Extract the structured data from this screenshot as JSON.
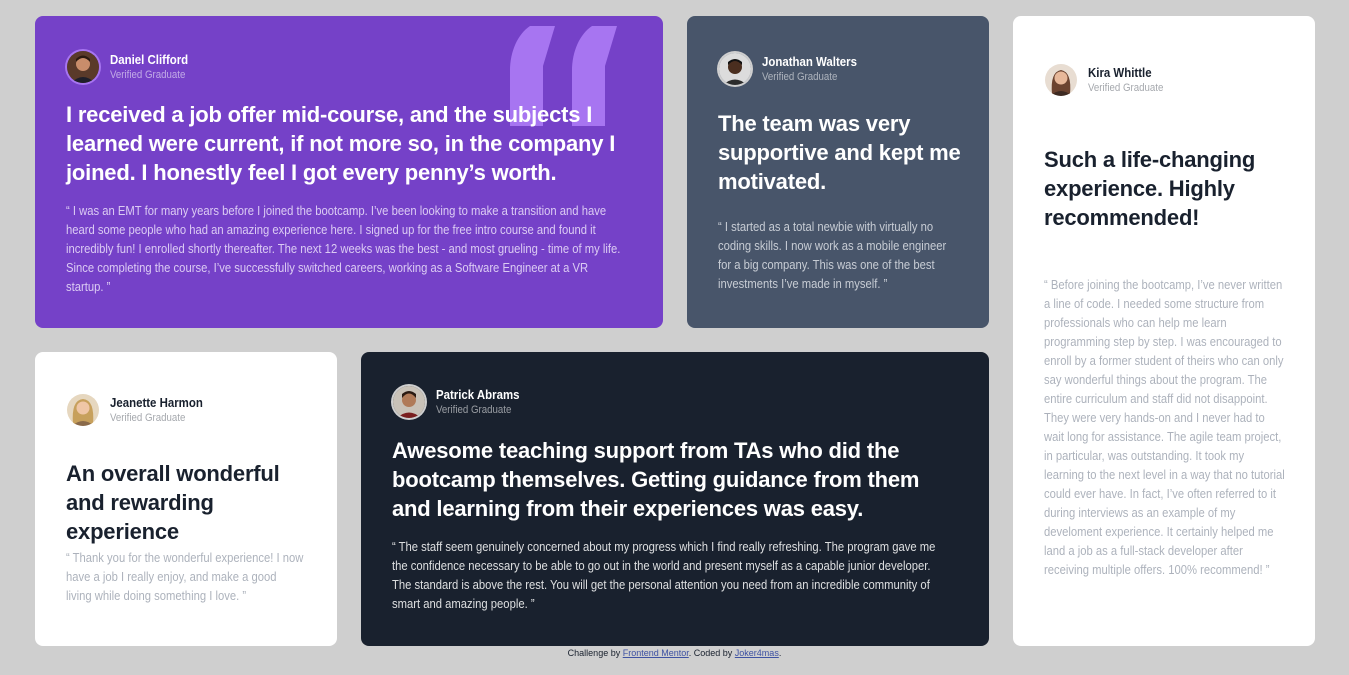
{
  "theme": {
    "daniel_bg": "#7541c8",
    "jonathan_bg": "#48556a",
    "kira_bg": "#ffffff",
    "jeanette_bg": "#ffffff",
    "patrick_bg": "#19212e",
    "page_bg": "#cfcfcf",
    "quote_mark_color": "#a775f1"
  },
  "testimonials": {
    "daniel": {
      "name": "Daniel Clifford",
      "role": "Verified Graduate",
      "avatar_icon": "avatar-daniel",
      "headline": "I received a job offer mid-course, and the subjects I learned were current, if not more so, in the company I joined. I honestly feel I got every penny’s worth.",
      "body": "“ I was an EMT for many years before I joined the bootcamp. I’ve been looking to make a transition and have heard some people who had an amazing experience here. I signed up for the free intro course and found it incredibly fun! I enrolled shortly thereafter. The next 12 weeks was the best - and most grueling - time of my life. Since completing the course, I’ve successfully switched careers, working as a Software Engineer at a VR startup. ”"
    },
    "jonathan": {
      "name": "Jonathan Walters",
      "role": "Verified Graduate",
      "avatar_icon": "avatar-jonathan",
      "headline": "The team was very supportive and kept me motivated.",
      "body": "“ I started as a total newbie with virtually no coding skills. I now work as a mobile engineer for a big company. This was one of the best investments I’ve made in myself. ”"
    },
    "kira": {
      "name": "Kira Whittle",
      "role": "Verified Graduate",
      "avatar_icon": "avatar-kira",
      "headline": "Such a life-changing experience. Highly recommended!",
      "body": "“ Before joining the bootcamp, I’ve never written a line of code. I needed some structure from professionals who can help me learn programming step by step. I was encouraged to enroll by a former student of theirs who can only say wonderful things about the program. The entire curriculum and staff did not disappoint. They were very hands-on and I never had to wait long for assistance. The agile team project, in particular, was outstanding. It took my learning to the next level in a way that no tutorial could ever have. In fact, I’ve often referred to it during interviews as an example of my develoment experience. It certainly helped me land a job as a full-stack developer after receiving multiple offers. 100% recommend! ”"
    },
    "jeanette": {
      "name": "Jeanette Harmon",
      "role": "Verified Graduate",
      "avatar_icon": "avatar-jeanette",
      "headline": "An overall wonderful and rewarding experience",
      "body": "“ Thank you for the wonderful experience! I now have a job I really enjoy, and make a good living while doing something I love. ”"
    },
    "patrick": {
      "name": "Patrick Abrams",
      "role": "Verified Graduate",
      "avatar_icon": "avatar-patrick",
      "headline": "Awesome teaching support from TAs who did the bootcamp themselves. Getting guidance from them and learning from their experiences was easy.",
      "body": "“ The staff seem genuinely concerned about my progress which I find really refreshing. The program gave me the confidence necessary to be able to go out in the world and present myself as a capable junior developer. The standard is above the rest. You will get the personal attention you need from an incredible community of smart and amazing people. ”"
    }
  },
  "attribution": {
    "prefix": "Challenge by ",
    "challenge_link": "Frontend Mentor",
    "middle": ". Coded by ",
    "author_link": "Joker4mas",
    "suffix": "."
  }
}
